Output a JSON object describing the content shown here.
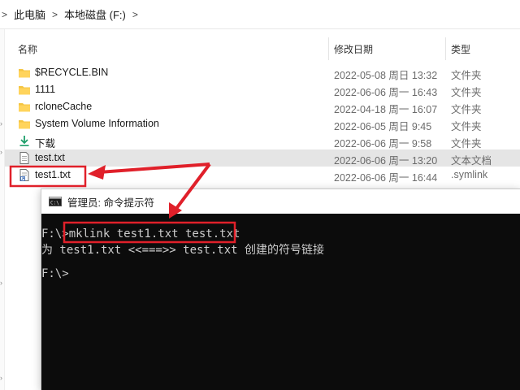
{
  "breadcrumb": {
    "items": [
      "此电脑",
      "本地磁盘 (F:)"
    ]
  },
  "columns": {
    "name": "名称",
    "modified": "修改日期",
    "type": "类型"
  },
  "files": [
    {
      "name": "$RECYCLE.BIN",
      "modified": "2022-05-08 周日 13:32",
      "type": "文件夹",
      "icon": "folder-icon"
    },
    {
      "name": "1111",
      "modified": "2022-06-06 周一 16:43",
      "type": "文件夹",
      "icon": "folder-icon"
    },
    {
      "name": "rcloneCache",
      "modified": "2022-04-18 周一 16:07",
      "type": "文件夹",
      "icon": "folder-icon"
    },
    {
      "name": "System Volume Information",
      "modified": "2022-06-05 周日 9:45",
      "type": "文件夹",
      "icon": "folder-icon"
    },
    {
      "name": "下载",
      "modified": "2022-06-06 周一 9:58",
      "type": "文件夹",
      "icon": "download-icon"
    },
    {
      "name": "test.txt",
      "modified": "2022-06-06 周一 13:20",
      "type": "文本文档",
      "icon": "text-file-icon"
    },
    {
      "name": "test1.txt",
      "modified": "2022-06-06 周一 16:44",
      "type": ".symlink",
      "icon": "symlink-file-icon"
    }
  ],
  "cmd": {
    "title": "管理员: 命令提示符",
    "lines": [
      "F:\\>mklink test1.txt test.txt",
      "为 test1.txt <<===>> test.txt 创建的符号链接",
      "",
      "F:\\>"
    ]
  },
  "colors": {
    "annotation_red": "#e0202a",
    "folder_yellow": "#f4c542",
    "console_bg": "#0c0c0c",
    "selected_row": "#e5e5e5"
  }
}
